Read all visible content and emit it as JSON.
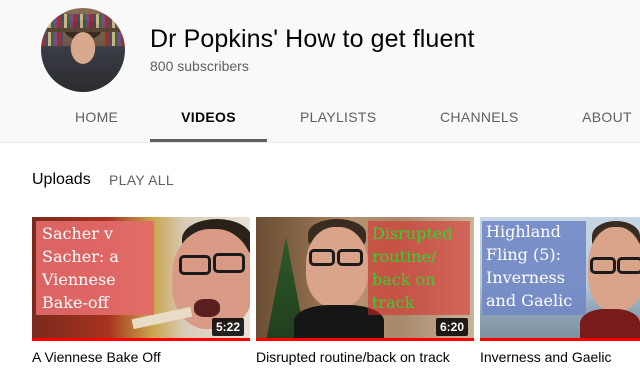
{
  "channel": {
    "title": "Dr Popkins' How to get fluent",
    "subscribers": "800 subscribers",
    "avatar_icon": "channel-avatar"
  },
  "tabs": [
    {
      "label": "HOME",
      "active": false
    },
    {
      "label": "VIDEOS",
      "active": true
    },
    {
      "label": "PLAYLISTS",
      "active": false
    },
    {
      "label": "CHANNELS",
      "active": false
    },
    {
      "label": "ABOUT",
      "active": false
    }
  ],
  "section": {
    "title": "Uploads",
    "play_all": "PLAY ALL"
  },
  "videos": [
    {
      "thumbnail_text": [
        "Sacher v",
        "Sacher: a",
        "Viennese",
        "Bake-off"
      ],
      "duration": "5:22",
      "title": "A Viennese Bake Off",
      "watched_fraction": 1.0
    },
    {
      "thumbnail_text": [
        "Disrupted",
        "routine/",
        "back on",
        "track"
      ],
      "duration": "6:20",
      "title": "Disrupted routine/back on track",
      "watched_fraction": 1.0
    },
    {
      "thumbnail_text": [
        "Highland",
        "Fling (5):",
        "Inverness",
        "and Gaelic"
      ],
      "duration": "",
      "title": "Inverness and Gaelic",
      "watched_fraction": 1.0
    }
  ],
  "colors": {
    "progress": "#ff0000",
    "thumb1_label_bg": "#e36a6a",
    "thumb2_label_text": "#2fd42f",
    "thumb3_label_bg": "#6f86c4"
  }
}
